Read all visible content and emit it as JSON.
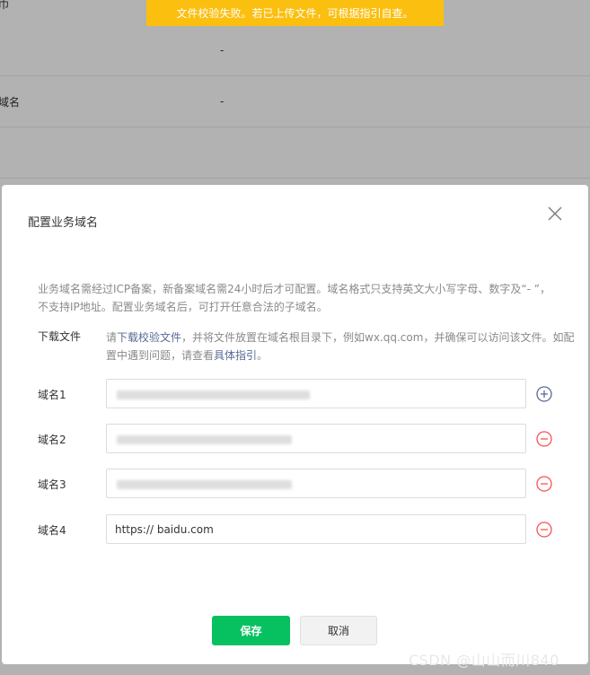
{
  "background": {
    "rows": [
      {
        "label": "",
        "value": "-"
      },
      {
        "label": "域名",
        "value": "-"
      }
    ]
  },
  "toast": {
    "message": "文件校验失败。若已上传文件，可根据指引自查。"
  },
  "dialog": {
    "title": "配置业务域名",
    "notice": "业务域名需经过ICP备案，新备案域名需24小时后才可配置。域名格式只支持英文大小写字母、数字及“- ”，不支持IP地址。配置业务域名后，可打开任意合法的子域名。",
    "download": {
      "label": "下载文件",
      "prefix": "请",
      "link1": "下载校验文件",
      "middle": "，并将文件放置在域名根目录下，例如wx.qq.com，并确保可以访问该文件。如配置中遇到问题，请查看",
      "link2": "具体指引",
      "suffix": "。"
    },
    "fields": [
      {
        "label": "域名1",
        "value": "",
        "action": "plus-circle-icon"
      },
      {
        "label": "域名2",
        "value": "",
        "action": "minus-circle-icon"
      },
      {
        "label": "域名3",
        "value": "",
        "action": "minus-circle-icon"
      },
      {
        "label": "域名4",
        "value": "https:// baidu.com",
        "action": "minus-circle-icon"
      }
    ],
    "save_label": "保存",
    "cancel_label": "取消"
  },
  "watermark": "CSDN @山山而川840",
  "colors": {
    "toast": "#fbbf0f",
    "primary": "#07c160",
    "link": "#576b95",
    "add_icon": "#576b95",
    "remove_icon": "#fa5151"
  }
}
